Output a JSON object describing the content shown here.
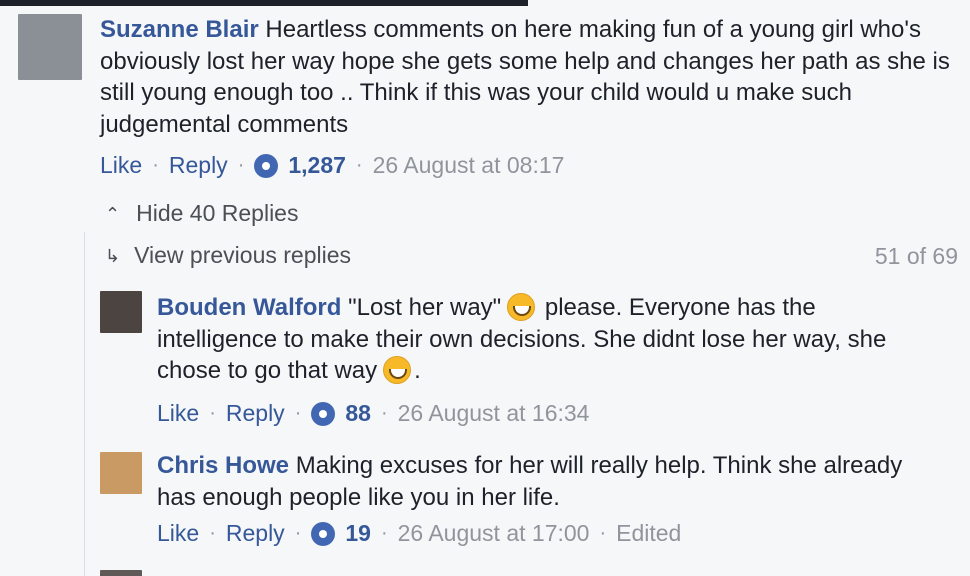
{
  "main_comment": {
    "author": "Suzanne Blair",
    "text": " Heartless comments on here making fun of a young girl who's obviously lost her way hope she gets some help and changes her path as she is still young enough too .. Think if this was your child would u make such judgemental comments",
    "like": "Like",
    "reply": "Reply",
    "reaction_count": "1,287",
    "timestamp": "26 August at 08:17"
  },
  "thread": {
    "hide_label": "Hide 40 Replies",
    "view_previous": "View previous replies",
    "page_count": "51 of 69"
  },
  "replies": [
    {
      "author": "Bouden Walford",
      "text_before": " \"Lost her way\"",
      "text_middle": " please. Everyone has the intelligence to make their own decisions. She didnt lose her way, she chose to go that way",
      "text_end": ".",
      "like": "Like",
      "reply": "Reply",
      "reaction_count": "88",
      "timestamp": "26 August at 16:34"
    },
    {
      "author": "Chris Howe",
      "text": " Making excuses for her will really help. Think she already has enough people like you in her life.",
      "like": "Like",
      "reply": "Reply",
      "reaction_count": "19",
      "timestamp": "26 August at 17:00",
      "edited": "Edited"
    }
  ],
  "colors": {
    "author": "#365899",
    "muted": "#90949c",
    "background": "#f6f7f9",
    "reaction": "#4267b2"
  }
}
